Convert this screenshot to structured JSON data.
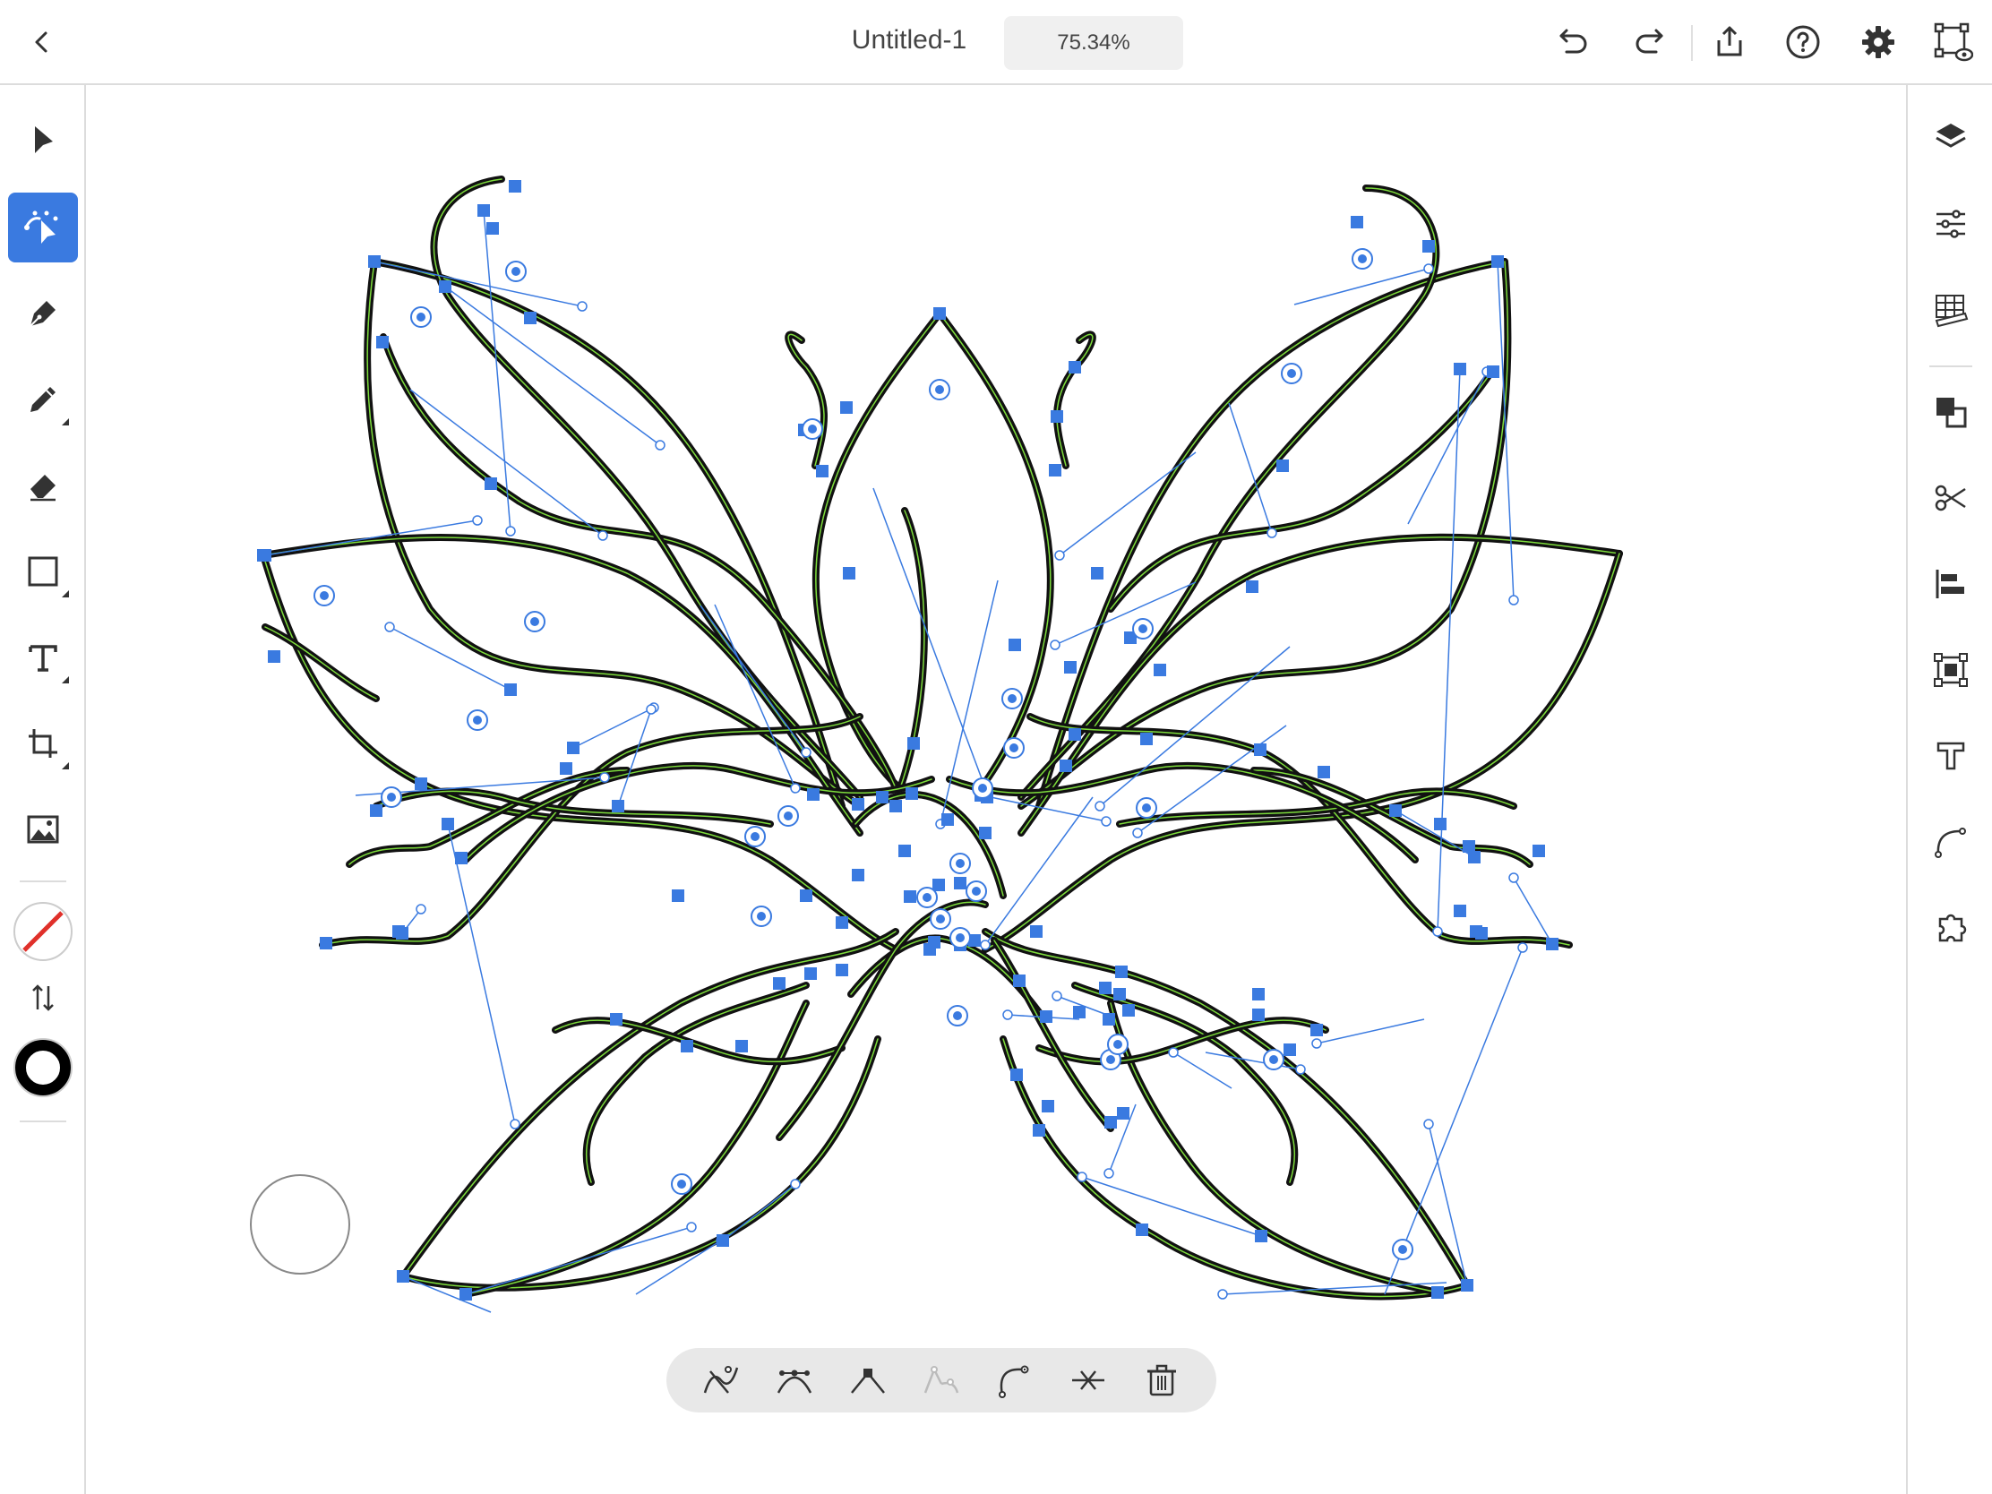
{
  "header": {
    "title": "Untitled-1",
    "zoom": "75.34%"
  },
  "left_toolbar": {
    "tools": [
      "selection",
      "direct-selection",
      "pen",
      "pencil",
      "eraser",
      "shape",
      "type",
      "transform",
      "image"
    ],
    "active_tool": "direct-selection",
    "fill": "none",
    "stroke": "black"
  },
  "right_panel": {
    "items": [
      "layers",
      "properties",
      "grid",
      "combine",
      "scissors",
      "align",
      "repeat",
      "type-properties",
      "path",
      "plugins"
    ]
  },
  "context_bar": {
    "items": [
      "simplify-path",
      "smooth-anchor",
      "corner-anchor",
      "convert-anchor",
      "join-path",
      "cut-path",
      "delete"
    ]
  },
  "colors": {
    "accent": "#3a7ae0",
    "stroke": "#111111",
    "path_highlight": "#7ddc3c",
    "handle": "#3a7ae0"
  }
}
